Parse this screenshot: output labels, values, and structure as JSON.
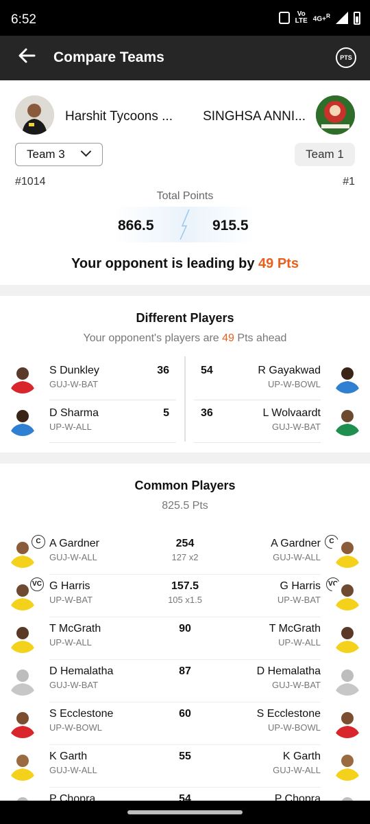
{
  "status_bar": {
    "time": "6:52",
    "lte_top": "Vo",
    "lte_bottom": "LTE",
    "network": "4G+",
    "network_sup": "R"
  },
  "app_bar": {
    "title": "Compare Teams",
    "pts_label": "PTS"
  },
  "teams": {
    "left": {
      "name": "Harshit Tycoons ...",
      "selector": "Team 3",
      "rank": "#1014",
      "points": "866.5"
    },
    "right": {
      "name": "SINGHSA ANNI...",
      "badge": "Team 1",
      "rank": "#1",
      "points": "915.5"
    },
    "total_points_label": "Total Points",
    "lead_text": "Your opponent is leading by ",
    "lead_value": "49 Pts"
  },
  "different_players": {
    "title": "Different Players",
    "sub_prefix": "Your opponent's players are ",
    "sub_value": "49",
    "sub_suffix": " Pts ahead",
    "left": [
      {
        "name": "S Dunkley",
        "team": "GUJ-W-BAT",
        "points": "36",
        "jersey": "#d8262c"
      },
      {
        "name": "D Sharma",
        "team": "UP-W-ALL",
        "points": "5",
        "jersey": "#2f7fd3"
      }
    ],
    "right": [
      {
        "name": "R Gayakwad",
        "team": "UP-W-BOWL",
        "points": "54",
        "jersey": "#2f7fd3"
      },
      {
        "name": "L Wolvaardt",
        "team": "GUJ-W-BAT",
        "points": "36",
        "jersey": "#1e8f4e"
      }
    ]
  },
  "common_players": {
    "title": "Common Players",
    "total": "825.5 Pts",
    "rows": [
      {
        "name": "A Gardner",
        "team": "GUJ-W-ALL",
        "points": "254",
        "calc": "127 x2",
        "role": "C",
        "jersey": "#f4d21c"
      },
      {
        "name": "G Harris",
        "team": "UP-W-BAT",
        "points": "157.5",
        "calc": "105 x1.5",
        "role": "VC",
        "jersey": "#f4d21c"
      },
      {
        "name": "T McGrath",
        "team": "UP-W-ALL",
        "points": "90",
        "calc": "",
        "role": "",
        "jersey": "#f4d21c"
      },
      {
        "name": "D Hemalatha",
        "team": "GUJ-W-BAT",
        "points": "87",
        "calc": "",
        "role": "",
        "jersey": "#c7c7c7"
      },
      {
        "name": "S Ecclestone",
        "team": "UP-W-BOWL",
        "points": "60",
        "calc": "",
        "role": "",
        "jersey": "#d8262c"
      },
      {
        "name": "K Garth",
        "team": "GUJ-W-ALL",
        "points": "55",
        "calc": "",
        "role": "",
        "jersey": "#f4d21c"
      },
      {
        "name": "P Chopra",
        "team": "",
        "points": "54",
        "calc": "",
        "role": "",
        "jersey": "#c7c7c7"
      }
    ]
  },
  "colors": {
    "accent": "#e8601c",
    "appbar": "#262626"
  }
}
